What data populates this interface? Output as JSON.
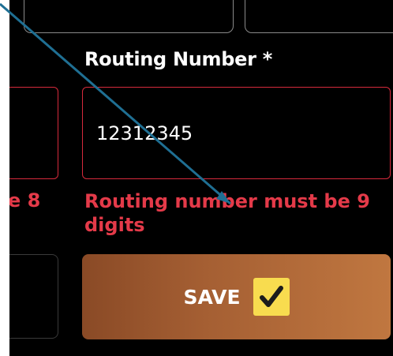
{
  "form": {
    "routing_label": "Routing Number *",
    "routing_value": "12312345",
    "routing_error": "Routing number must be 9 digits",
    "left_error_fragment": "e 8"
  },
  "actions": {
    "save_label": "SAVE",
    "save_icon": "checkmark-icon"
  },
  "colors": {
    "error": "#e43a49",
    "error_border": "#d62a3c",
    "save_gradient_start": "#8a4a26",
    "save_gradient_end": "#c07740",
    "check_badge": "#f8dc4f",
    "annotation_arrow": "#1f6f93"
  }
}
